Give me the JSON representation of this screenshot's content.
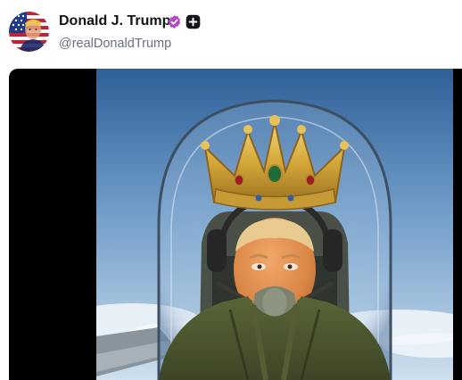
{
  "post": {
    "author": {
      "display_name": "Donald J. Trump",
      "handle": "@realDonaldTrump",
      "avatar_icon": "flag-portrait-avatar",
      "verified_icon": "verified-badge-icon",
      "follow_icon": "plus-icon"
    },
    "media": {
      "type": "image",
      "overlay_icon": "crown"
    }
  },
  "colors": {
    "name_text": "#111418",
    "handle_text": "#6b7080",
    "verified_badge": "#b548c6",
    "follow_badge": "#111418",
    "media_background": "#000000"
  }
}
